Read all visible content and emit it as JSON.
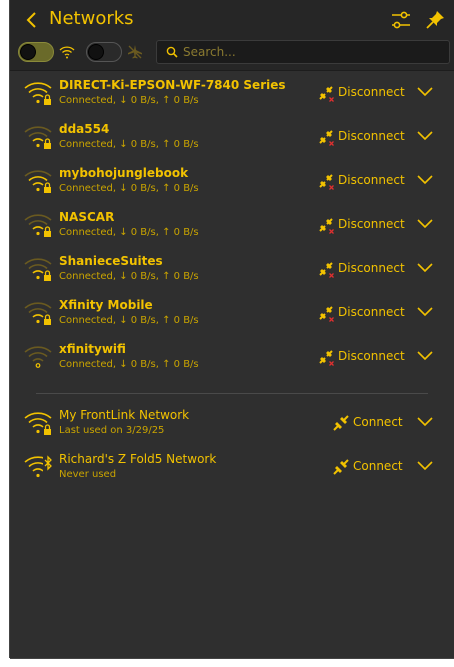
{
  "header": {
    "title": "Networks",
    "search_placeholder": "Search..."
  },
  "networks": [
    {
      "name": "DIRECT-Ki-EPSON-WF-7840 Series",
      "status": "Connected, ↓ 0 B/s, ↑ 0 B/s",
      "action": "Disconnect"
    },
    {
      "name": "dda554",
      "status": "Connected, ↓ 0 B/s, ↑ 0 B/s",
      "action": "Disconnect"
    },
    {
      "name": "mybohojunglebook",
      "status": "Connected, ↓ 0 B/s, ↑ 0 B/s",
      "action": "Disconnect"
    },
    {
      "name": "NASCAR",
      "status": "Connected, ↓ 0 B/s, ↑ 0 B/s",
      "action": "Disconnect"
    },
    {
      "name": "ShanieceSuites",
      "status": "Connected, ↓ 0 B/s, ↑ 0 B/s",
      "action": "Disconnect"
    },
    {
      "name": "Xfinity Mobile",
      "status": "Connected, ↓ 0 B/s, ↑ 0 B/s",
      "action": "Disconnect"
    },
    {
      "name": "xfinitywifi",
      "status": "Connected, ↓ 0 B/s, ↑ 0 B/s",
      "action": "Disconnect"
    }
  ],
  "saved_networks": [
    {
      "name": "My FrontLink Network",
      "status": "Last used on 3/29/25",
      "action": "Connect"
    },
    {
      "name": "Richard's Z Fold5 Network",
      "status": "Never used",
      "action": "Connect"
    }
  ],
  "colors": {
    "accent": "#f2c200",
    "background": "#2f2f2f",
    "header": "#262626",
    "error": "#e03030"
  }
}
